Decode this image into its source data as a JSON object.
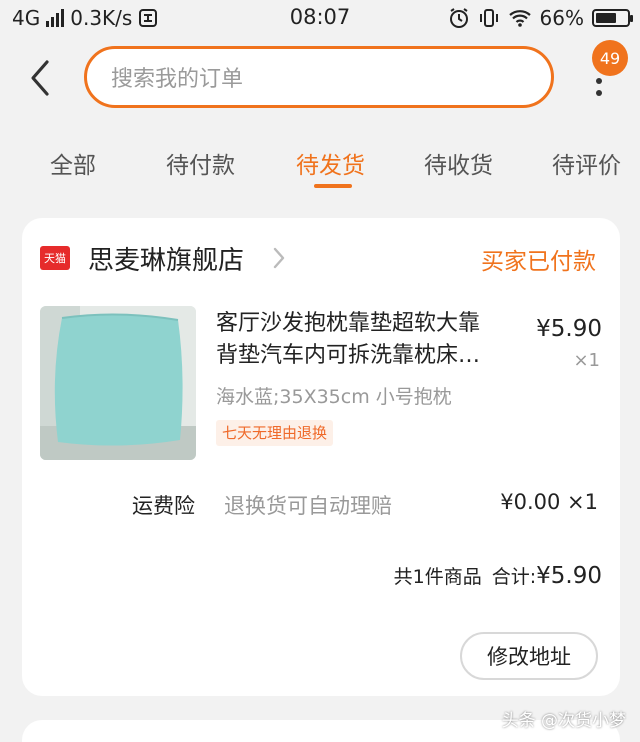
{
  "status_bar": {
    "network": "4G",
    "speed": "0.3K/s",
    "time": "08:07",
    "battery": "66%",
    "battery_level": 0.66
  },
  "header": {
    "search_placeholder": "搜索我的订单",
    "badge_count": "49"
  },
  "tabs": [
    {
      "label": "全部",
      "active": false
    },
    {
      "label": "待付款",
      "active": false
    },
    {
      "label": "待发货",
      "active": true
    },
    {
      "label": "待收货",
      "active": false
    },
    {
      "label": "待评价",
      "active": false
    }
  ],
  "order": {
    "shop_logo_text": "天猫",
    "shop_name": "思麦琳旗舰店",
    "status": "买家已付款",
    "product": {
      "title_line1": "客厅沙发抱枕靠垫超软大靠",
      "title_line2": "背垫汽车内可拆洗靠枕床…",
      "sku": "海水蓝;35X35cm 小号抱枕",
      "tag": "七天无理由退换",
      "price": "¥5.90",
      "qty": "×1"
    },
    "insurance": {
      "label": "运费险",
      "desc": "退换货可自动理赔",
      "price": "¥0.00 ×1"
    },
    "summary": {
      "count_text": "共1件商品",
      "total_label": "合计:",
      "total": "¥5.90"
    },
    "action_label": "修改地址"
  },
  "watermark": "头条 @次货小梦",
  "colors": {
    "accent": "#f0731d",
    "tmall_red": "#e62b2b",
    "pillow": "#8fd3cf"
  },
  "icons": [
    "signal-icon",
    "hotspot-icon",
    "alarm-icon",
    "vibrate-icon",
    "wifi-icon",
    "battery-icon",
    "back-arrow-icon",
    "more-icon",
    "tmall-logo-icon",
    "chevron-right-icon"
  ]
}
